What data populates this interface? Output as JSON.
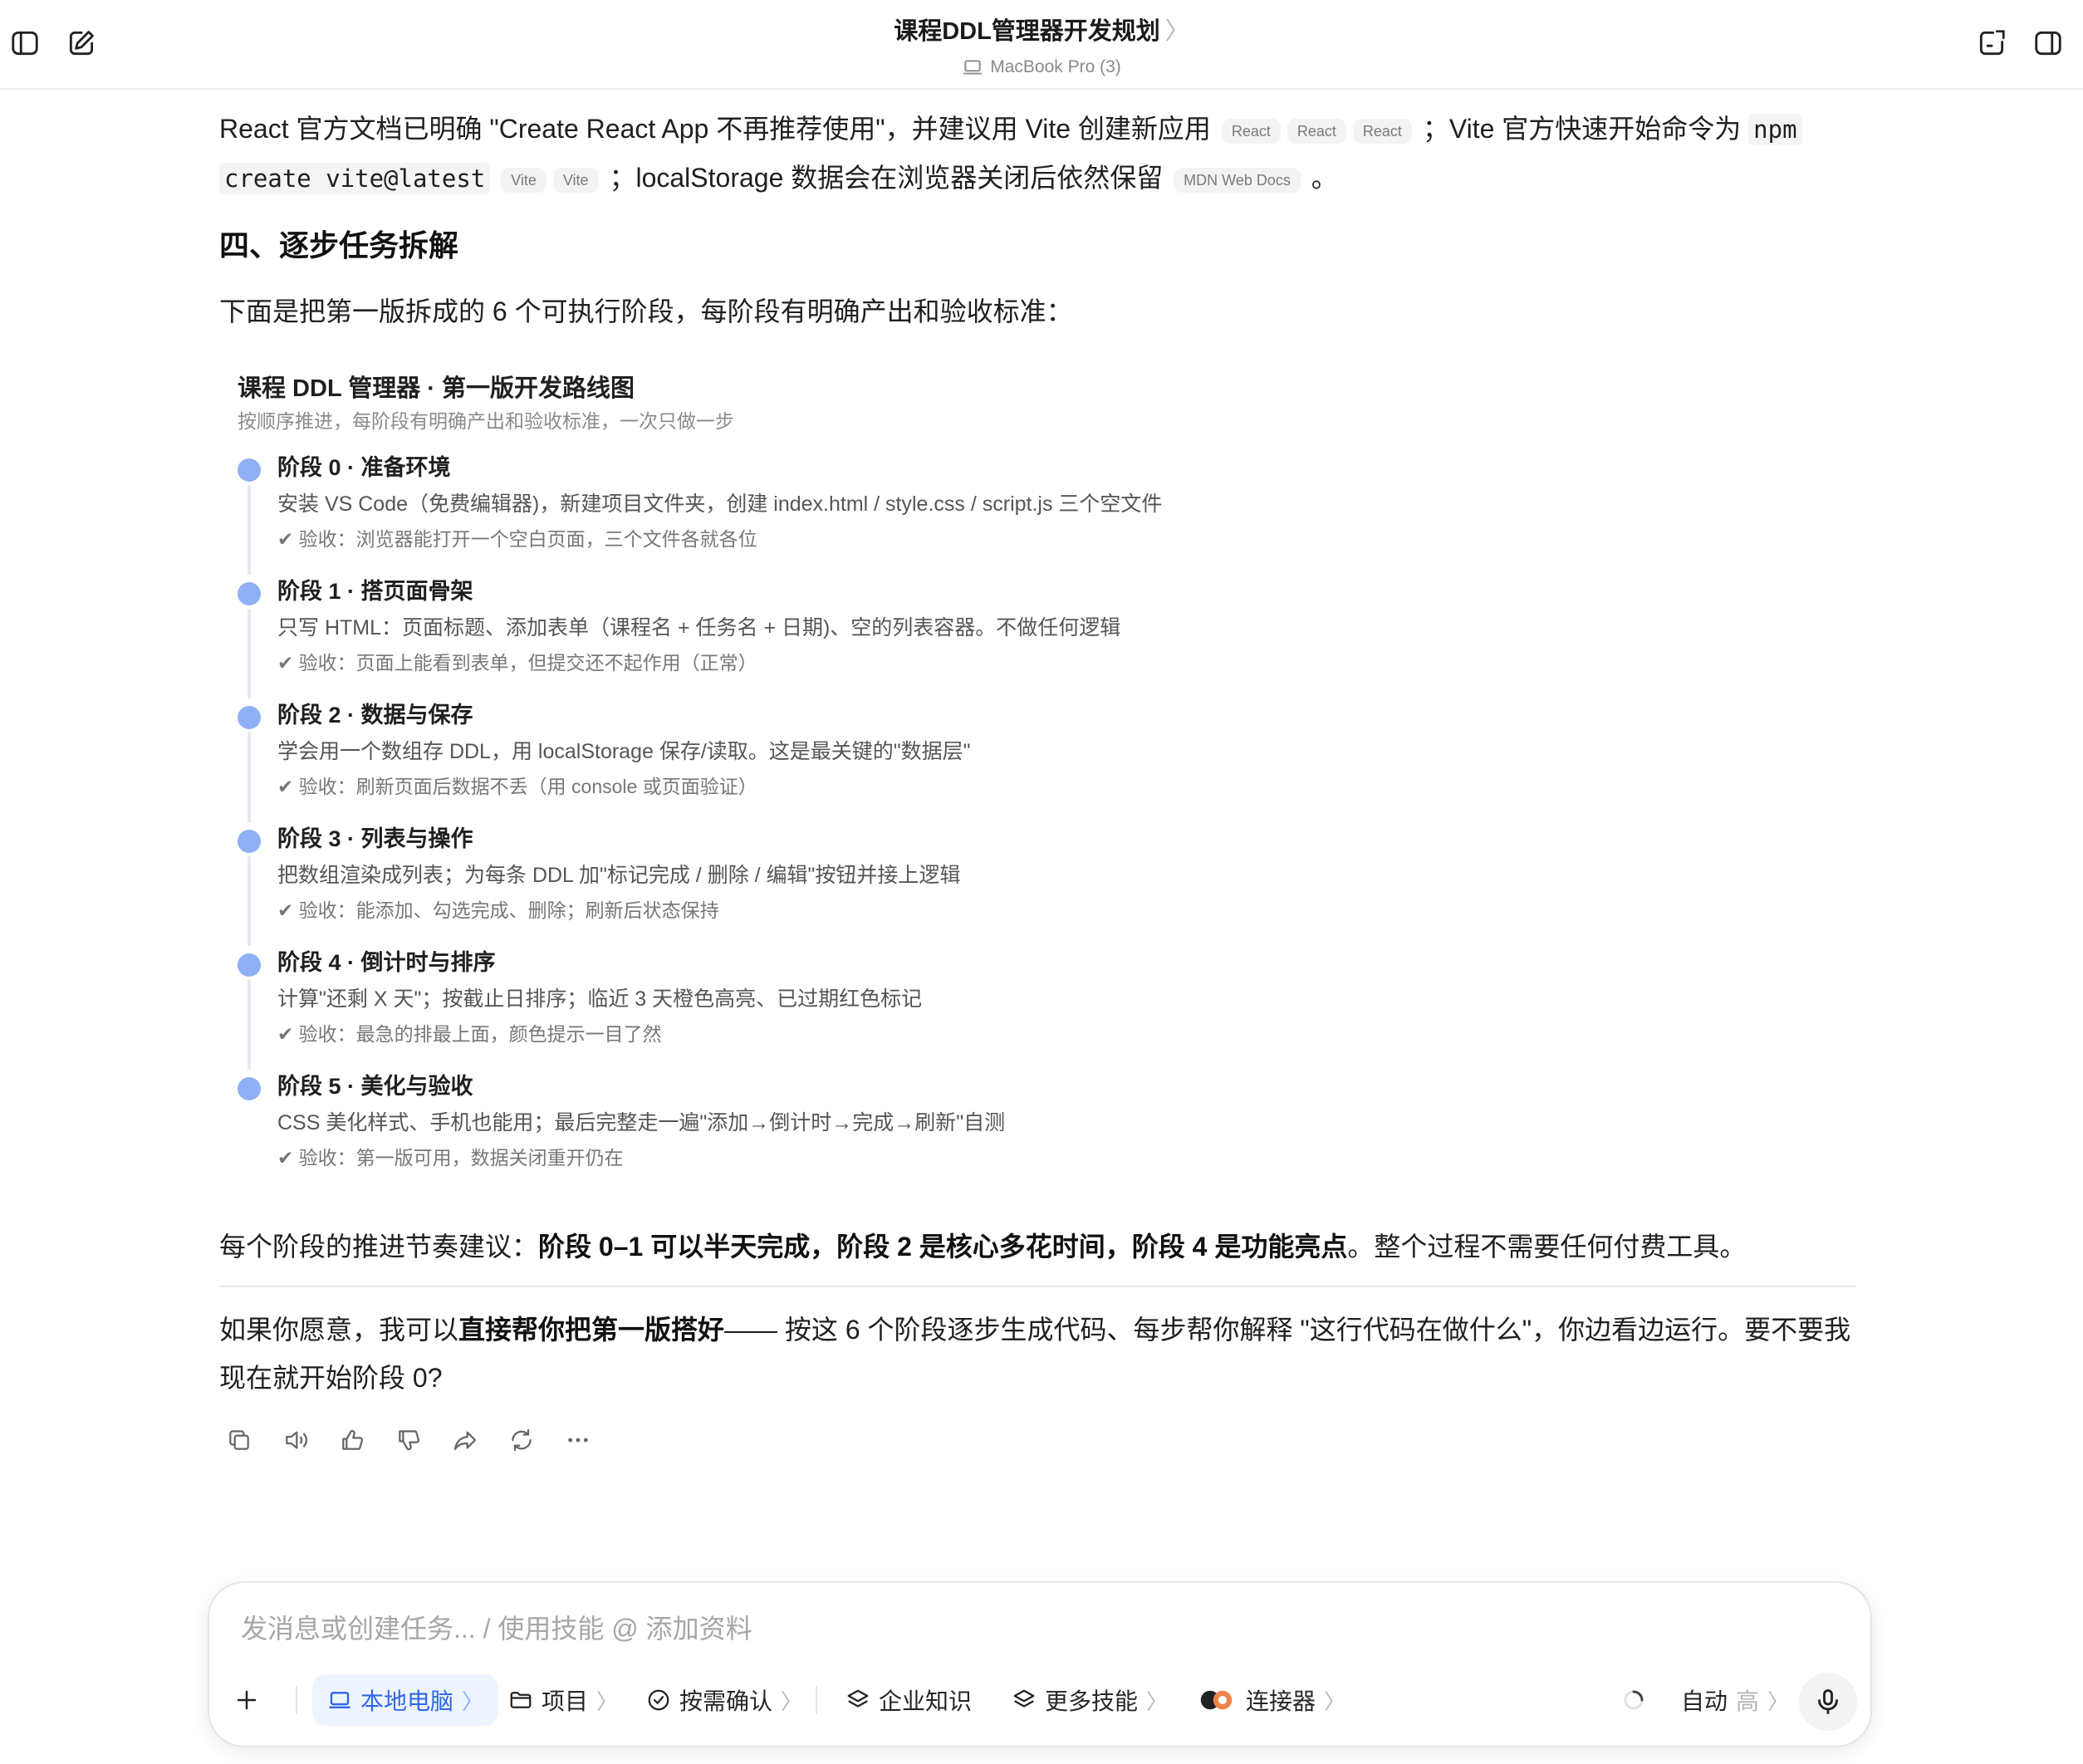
{
  "header": {
    "title": "课程DDL管理器开发规划",
    "title_chevron": "〉",
    "device": "MacBook Pro (3)"
  },
  "content": {
    "p1": {
      "t1": "React 官方文档已明确 \"Create React App 不再推荐使用\"，并建议用 Vite 创建新应用",
      "chips1": [
        "React",
        "React",
        "React"
      ],
      "t2": "；Vite 官方快速开始命令为",
      "code1": "npm",
      "code2": "create vite@latest",
      "chips2": [
        "Vite",
        "Vite"
      ],
      "t3": "；localStorage 数据会在浏览器关闭后依然保留",
      "chip3": "MDN Web Docs",
      "t4": "。"
    },
    "section_heading": "四、逐步任务拆解",
    "intro": "下面是把第一版拆成的 6 个可执行阶段，每阶段有明确产出和验收标准：",
    "roadmap": {
      "title": "课程 DDL 管理器 · 第一版开发路线图",
      "subtitle": "按顺序推进，每阶段有明确产出和验收标准，一次只做一步",
      "stages": [
        {
          "title": "阶段 0 · 准备环境",
          "desc": "安装 VS Code（免费编辑器)，新建项目文件夹，创建 index.html / style.css / script.js 三个空文件",
          "check": "✔ 验收：浏览器能打开一个空白页面，三个文件各就各位"
        },
        {
          "title": "阶段 1 · 搭页面骨架",
          "desc": "只写 HTML：页面标题、添加表单（课程名 + 任务名 + 日期)、空的列表容器。不做任何逻辑",
          "check": "✔ 验收：页面上能看到表单，但提交还不起作用（正常）"
        },
        {
          "title": "阶段 2 · 数据与保存",
          "desc": "学会用一个数组存 DDL，用 localStorage 保存/读取。这是最关键的\"数据层\"",
          "check": "✔ 验收：刷新页面后数据不丢（用 console 或页面验证）"
        },
        {
          "title": "阶段 3 · 列表与操作",
          "desc": "把数组渲染成列表；为每条 DDL 加\"标记完成 / 删除 / 编辑\"按钮并接上逻辑",
          "check": "✔ 验收：能添加、勾选完成、删除；刷新后状态保持"
        },
        {
          "title": "阶段 4 · 倒计时与排序",
          "desc": "计算\"还剩 X 天\"；按截止日排序；临近 3 天橙色高亮、已过期红色标记",
          "check": "✔ 验收：最急的排最上面，颜色提示一目了然"
        },
        {
          "title": "阶段 5 · 美化与验收",
          "desc": "CSS 美化样式、手机也能用；最后完整走一遍\"添加→倒计时→完成→刷新\"自测",
          "check": "✔ 验收：第一版可用，数据关闭重开仍在"
        }
      ]
    },
    "note": {
      "lead": "每个阶段的推进节奏建议：",
      "bold": "阶段 0–1 可以半天完成，阶段 2 是核心多花时间，阶段 4 是功能亮点",
      "tail": "。整个过程不需要任何付费工具。"
    },
    "offer": {
      "lead": "如果你愿意，我可以",
      "bold": "直接帮你把第一版搭好",
      "tail": "—— 按这 6 个阶段逐步生成代码、每步帮你解释 \"这行代码在做什么\"，你边看边运行。要不要我现在就开始阶段 0?"
    }
  },
  "composer": {
    "placeholder": "发消息或创建任务... / 使用技能 @ 添加资料",
    "tools": {
      "local": "本地电脑",
      "project": "项目",
      "confirm": "按需确认",
      "knowledge": "企业知识",
      "skills": "更多技能",
      "connectors": "连接器",
      "auto": "自动",
      "level": "高"
    },
    "chevron": "〉"
  },
  "colors": {
    "accent": "#2f67e8",
    "timeline_dot": "#8fb0f5"
  }
}
